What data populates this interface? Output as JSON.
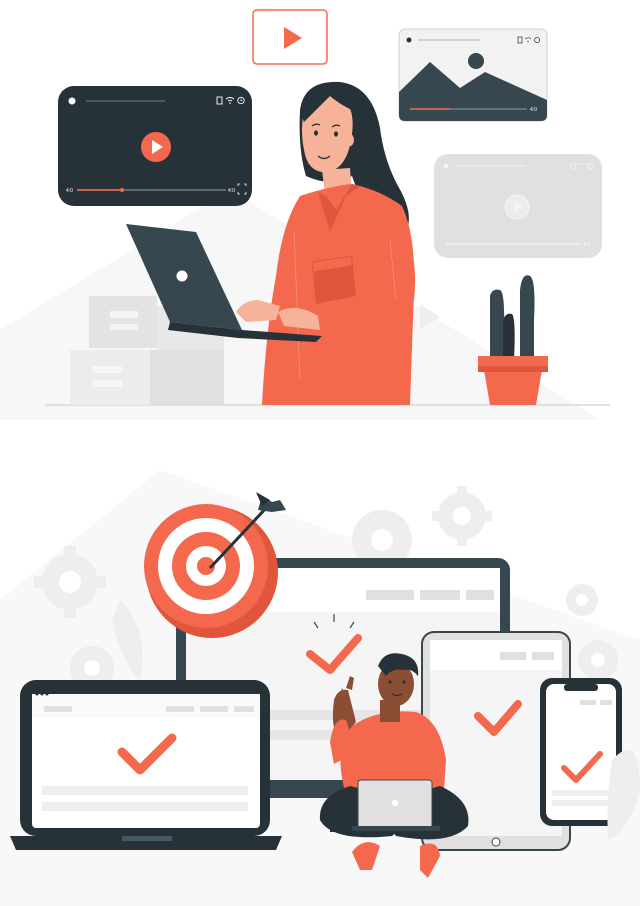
{
  "illustration_top": {
    "dark_player": {
      "time_start": "4:0",
      "time_end": "4:0"
    },
    "landscape_player": {
      "time_end": "4:0"
    },
    "gray_player": {
      "time_end": "4:0"
    }
  },
  "colors": {
    "accent": "#f4694e",
    "accent_dark": "#e0553b",
    "dark": "#263238",
    "slate": "#37474f",
    "light_gray": "#e0e0e0",
    "bg_gray": "#f5f5f5",
    "skin": "#f6b39a",
    "skin_dark": "#8b4e34",
    "hair": "#263238"
  },
  "icons": [
    "play-icon",
    "bookmark-icon",
    "wifi-icon",
    "clock-icon",
    "fullscreen-icon",
    "checkmark-icon",
    "target-icon",
    "arrow-icon",
    "gear-icon",
    "cactus-icon"
  ]
}
